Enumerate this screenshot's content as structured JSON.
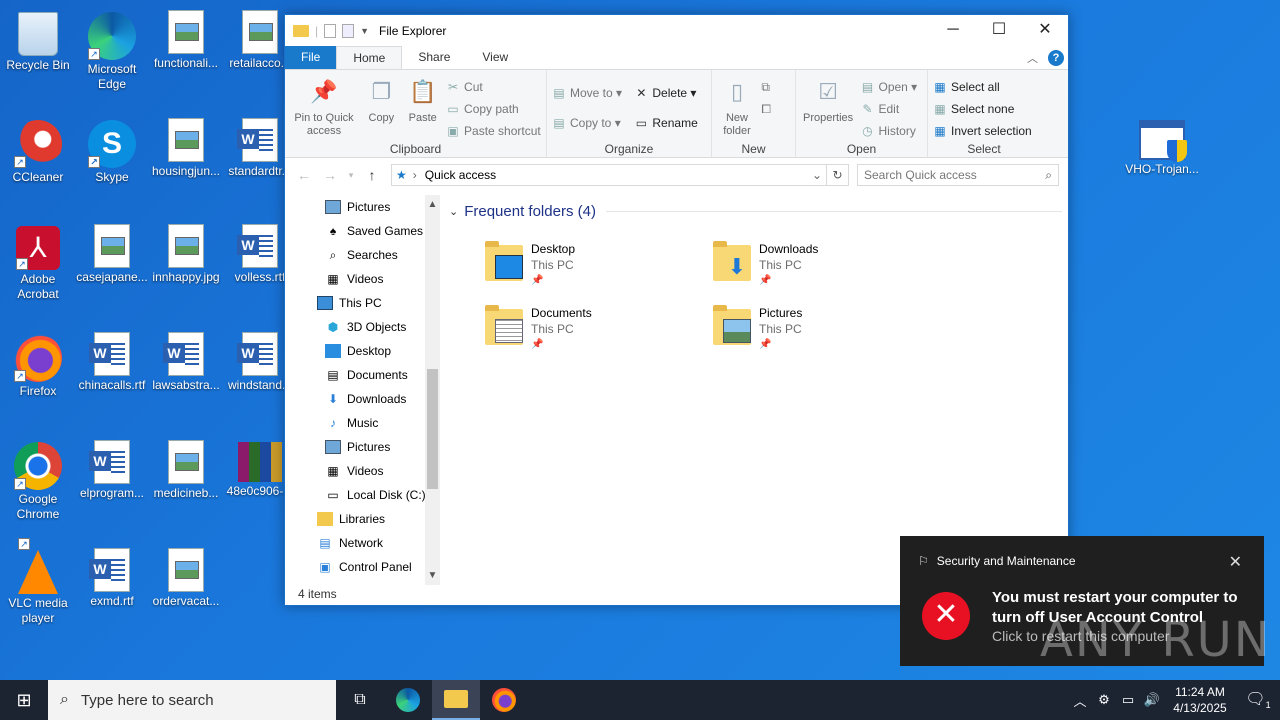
{
  "desktop": {
    "icons": [
      {
        "label": "Recycle Bin"
      },
      {
        "label": "Microsoft Edge"
      },
      {
        "label": "functionali..."
      },
      {
        "label": "retailacco..."
      },
      {
        "label": "CCleaner"
      },
      {
        "label": "Skype"
      },
      {
        "label": "housingjun..."
      },
      {
        "label": "standardtr..."
      },
      {
        "label": "Adobe Acrobat"
      },
      {
        "label": "casejapane..."
      },
      {
        "label": "innhappy.jpg"
      },
      {
        "label": "volless.rtf"
      },
      {
        "label": "Firefox"
      },
      {
        "label": "chinacalls.rtf"
      },
      {
        "label": "lawsabstra..."
      },
      {
        "label": "windstand..."
      },
      {
        "label": "Google Chrome"
      },
      {
        "label": "elprogram..."
      },
      {
        "label": "medicineb..."
      },
      {
        "label": "48e0c906-..."
      },
      {
        "label": "VLC media player"
      },
      {
        "label": "exmd.rtf"
      },
      {
        "label": "ordervacat..."
      },
      {
        "label": "VHO-Trojan..."
      }
    ]
  },
  "explorer": {
    "title": "File Explorer",
    "tabs": {
      "file": "File",
      "home": "Home",
      "share": "Share",
      "view": "View"
    },
    "ribbon": {
      "clipboard": {
        "label": "Clipboard",
        "pin": "Pin to Quick access",
        "copy": "Copy",
        "paste": "Paste",
        "cut": "Cut",
        "copy_path": "Copy path",
        "paste_shortcut": "Paste shortcut"
      },
      "organize": {
        "label": "Organize",
        "move_to": "Move to",
        "copy_to": "Copy to",
        "delete": "Delete",
        "rename": "Rename"
      },
      "new": {
        "label": "New",
        "new_folder": "New folder"
      },
      "open": {
        "label": "Open",
        "properties": "Properties",
        "open": "Open",
        "edit": "Edit",
        "history": "History"
      },
      "select": {
        "label": "Select",
        "select_all": "Select all",
        "select_none": "Select none",
        "invert": "Invert selection"
      }
    },
    "address": {
      "path": "Quick access",
      "search_placeholder": "Search Quick access"
    },
    "nav": [
      {
        "label": "Pictures",
        "icon": "pictures-icon"
      },
      {
        "label": "Saved Games",
        "icon": "saved-games-icon"
      },
      {
        "label": "Searches",
        "icon": "search-icon"
      },
      {
        "label": "Videos",
        "icon": "videos-icon"
      },
      {
        "label": "This PC",
        "icon": "pc-icon"
      },
      {
        "label": "3D Objects",
        "icon": "cube-icon"
      },
      {
        "label": "Desktop",
        "icon": "desktop-icon"
      },
      {
        "label": "Documents",
        "icon": "documents-icon"
      },
      {
        "label": "Downloads",
        "icon": "download-icon"
      },
      {
        "label": "Music",
        "icon": "music-icon"
      },
      {
        "label": "Pictures",
        "icon": "pictures-icon"
      },
      {
        "label": "Videos",
        "icon": "videos-icon"
      },
      {
        "label": "Local Disk (C:)",
        "icon": "disk-icon"
      },
      {
        "label": "Libraries",
        "icon": "libraries-icon"
      },
      {
        "label": "Network",
        "icon": "network-icon"
      },
      {
        "label": "Control Panel",
        "icon": "control-panel-icon"
      }
    ],
    "content": {
      "group_title": "Frequent folders (4)",
      "folders": [
        {
          "name": "Desktop",
          "location": "This PC"
        },
        {
          "name": "Downloads",
          "location": "This PC"
        },
        {
          "name": "Documents",
          "location": "This PC"
        },
        {
          "name": "Pictures",
          "location": "This PC"
        }
      ]
    },
    "status": "4 items"
  },
  "toast": {
    "app": "Security and Maintenance",
    "message": "You must restart your computer to turn off User Account Control",
    "sub": "Click to restart this computer"
  },
  "watermark": "ANY RUN",
  "taskbar": {
    "search_placeholder": "Type here to search",
    "time": "11:24 AM",
    "date": "4/13/2025",
    "notification_count": "1"
  },
  "colors": {
    "accent": "#1979ca",
    "desktop": "#1a78dc",
    "taskbar": "#1c2432",
    "error": "#e81123"
  }
}
